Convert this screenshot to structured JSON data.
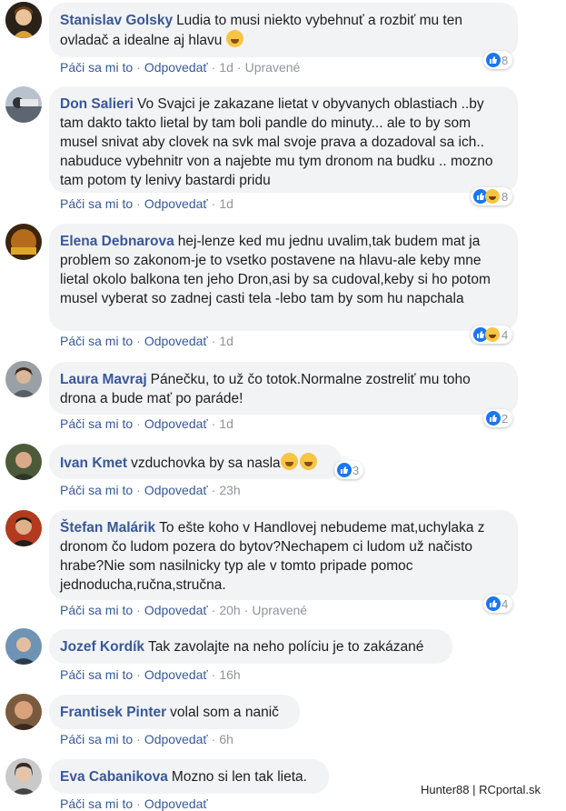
{
  "actions": {
    "like": "Páči sa mi to",
    "reply": "Odpovedať",
    "edited": "Upravené"
  },
  "comments": [
    {
      "author": "Stanislav Golsky",
      "text": "Ludia to musi niekto vybehnuť a rozbiť mu ten ovladač a idealne aj hlavu",
      "time": "1d",
      "edited": true,
      "reactions": "8",
      "reaction_types": [
        "like"
      ]
    },
    {
      "author": "Don Salieri",
      "text": "Vo Svajci je zakazane lietat v obyvanych oblastiach ..by tam dakto takto lietal by tam boli pandle do minuty... ale to by som musel snivat aby clovek na svk mal svoje prava a dozadoval sa ich.. nabuduce vybehnitr von a najebte mu tym dronom na budku .. mozno tam potom ty lenivy bastardi pridu",
      "time": "1d",
      "edited": false,
      "reactions": "8",
      "reaction_types": [
        "like",
        "haha"
      ]
    },
    {
      "author": "Elena Debnarova",
      "text": "hej-lenze ked mu jednu uvalim,tak budem mat ja problem so zakonom-je to vsetko postavene na hlavu-ale keby mne lietal okolo balkona ten jeho Dron,asi by sa cudoval,keby si ho potom musel vyberat so zadnej casti tela -lebo tam by som hu napchala",
      "time": "1d",
      "edited": false,
      "reactions": "4",
      "reaction_types": [
        "like",
        "haha"
      ]
    },
    {
      "author": "Laura Mavraj",
      "text": "Pánečku, to už čo totok.Normalne zostreliť mu toho drona a bude mať po paráde!",
      "time": "1d",
      "edited": false,
      "reactions": "2",
      "reaction_types": [
        "like"
      ]
    },
    {
      "author": "Ivan Kmet",
      "text": "vzduchovka by sa nasla",
      "time": "23h",
      "edited": false,
      "reactions": "3",
      "reaction_types": [
        "like"
      ]
    },
    {
      "author": "Štefan Malárik",
      "text": "To ešte koho v Handlovej nebudeme mat,uchylaka z dronom čo ludom pozera do bytov?Nechapem ci ludom už načisto hrabe?Nie som nasilnicky typ ale v tomto pripade pomoc jednoducha,ručna,stručna.",
      "time": "20h",
      "edited": true,
      "reactions": "4",
      "reaction_types": [
        "like"
      ]
    },
    {
      "author": "Jozef Kordík",
      "text": "Tak zavolajte na neho políciu je to zakázané",
      "time": "16h",
      "edited": false,
      "reactions": "",
      "reaction_types": []
    },
    {
      "author": "Frantisek Pinter",
      "text": "volal som a nanič",
      "time": "6h",
      "edited": false,
      "reactions": "",
      "reaction_types": []
    },
    {
      "author": "Eva Cabanikova",
      "text": "Mozno si len tak lieta.",
      "time": "",
      "edited": false,
      "reactions": "",
      "reaction_types": []
    }
  ],
  "watermark": "Hunter88 | RCportal.sk",
  "colors": {
    "link": "#385898",
    "bubble": "#f2f3f5",
    "meta": "#90949c",
    "like": "#1877f2"
  },
  "icons": [
    "like-icon",
    "haha-icon",
    "smile-emoji-icon",
    "laugh-emoji-icon"
  ]
}
